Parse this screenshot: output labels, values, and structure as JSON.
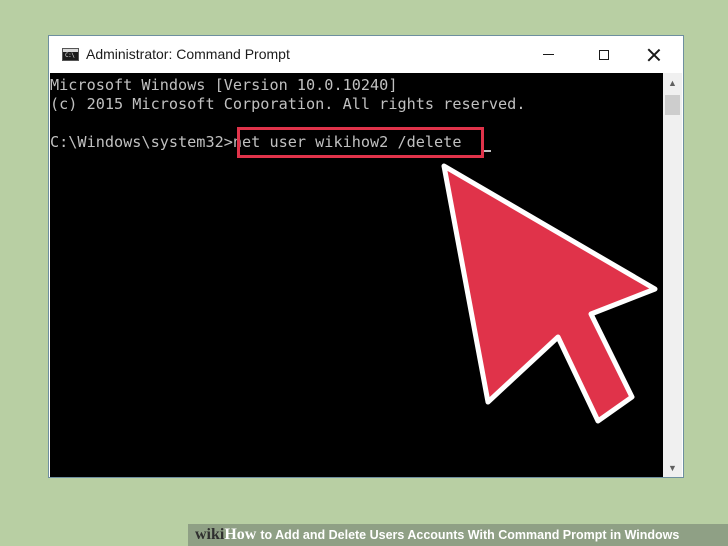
{
  "window": {
    "title": "Administrator: Command Prompt",
    "icon": "cmd-icon",
    "icon_text": "C:\\"
  },
  "console": {
    "lines": [
      "Microsoft Windows [Version 10.0.10240]",
      "(c) 2015 Microsoft Corporation. All rights reserved.",
      "C:\\Windows\\system32>net user wikihow2 /delete"
    ]
  },
  "annotation": {
    "highlight_color": "#e0334a",
    "arrow_color": "#e0334a"
  },
  "caption": {
    "brand_wiki": "wiki",
    "brand_how": "How",
    "text": "to Add and Delete Users Accounts With Command Prompt in Windows"
  },
  "colors": {
    "background": "#b8cfa3",
    "console_bg": "#000000",
    "console_text": "#c0c0c0"
  }
}
